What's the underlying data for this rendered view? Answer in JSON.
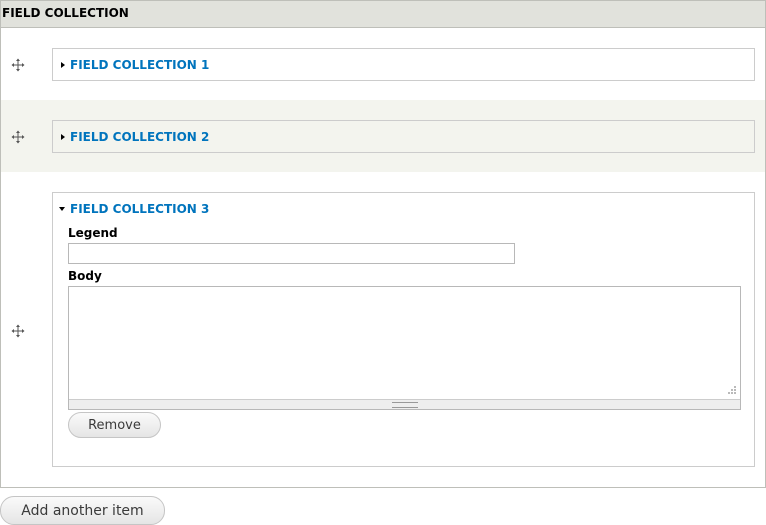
{
  "header": {
    "title": "FIELD COLLECTION"
  },
  "items": [
    {
      "legend": "FIELD COLLECTION 1",
      "expanded": false
    },
    {
      "legend": "FIELD COLLECTION 2",
      "expanded": false
    },
    {
      "legend": "FIELD COLLECTION 3",
      "expanded": true,
      "legend_field_label": "Legend",
      "legend_field_value": "",
      "body_field_label": "Body",
      "body_field_value": "",
      "remove_label": "Remove"
    }
  ],
  "add_another_label": "Add another item",
  "colors": {
    "header_bg": "#e1e2dc",
    "even_row_bg": "#f3f4ee",
    "link": "#0074bd",
    "border": "#bebfb9"
  },
  "icons": {
    "drag": "move-cross-icon",
    "collapsed": "triangle-right-icon",
    "expanded": "triangle-down-icon"
  }
}
